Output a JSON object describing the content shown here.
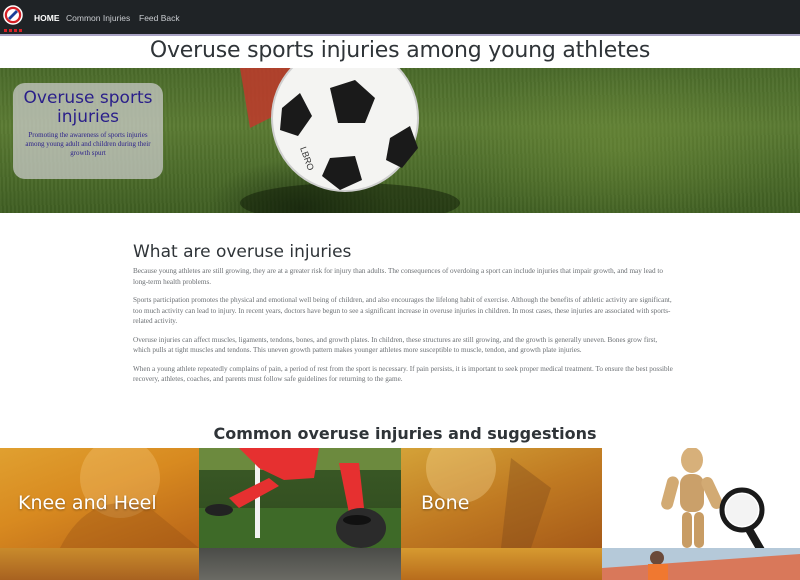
{
  "nav": {
    "home": "HOME",
    "common_injuries": "Common Injuries",
    "feedback": "Feed Back"
  },
  "page_title": "Overuse sports injuries among young athletes",
  "hero": {
    "card_title": "Overuse sports injuries",
    "card_text": "Promoting the awareness of sports injuries among young adult and children during their growth spurt"
  },
  "section": {
    "title": "What are overuse injuries",
    "paragraphs": [
      "Because young athletes are still growing, they are at a greater risk for injury than adults. The consequences of overdoing a sport can include injuries that impair growth, and may lead to long-term health problems.",
      "Sports participation promotes the physical and emotional well being of children, and also encourages the lifelong habit of exercise. Although the benefits of athletic activity are significant, too much activity can lead to injury. In recent years, doctors have begun to see a significant increase in overuse injuries in children. In most cases, these injuries are associated with sports-related activity.",
      "Overuse injuries can affect muscles, ligaments, tendons, bones, and growth plates. In children, these structures are still growing, and the growth is generally uneven. Bones grow first, which pulls at tight muscles and tendons. This uneven growth pattern makes younger athletes more susceptible to muscle, tendon, and growth plate injuries.",
      "When a young athlete repeatedly complains of pain, a period of rest from the sport is necessary. If pain persists, it is important to seek proper medical treatment. To ensure the best possible recovery, athletes, coaches, and parents must follow safe guidelines for returning to the game."
    ]
  },
  "injuries": {
    "title": "Common overuse injuries and suggestions",
    "tiles": [
      {
        "label": "Knee and Heel"
      },
      {
        "label": ""
      },
      {
        "label": "Bone"
      },
      {
        "label": ""
      }
    ]
  },
  "colors": {
    "navbar": "#1f2326",
    "title_text": "#2a1f8a",
    "tile_orange": "#d88a20"
  }
}
